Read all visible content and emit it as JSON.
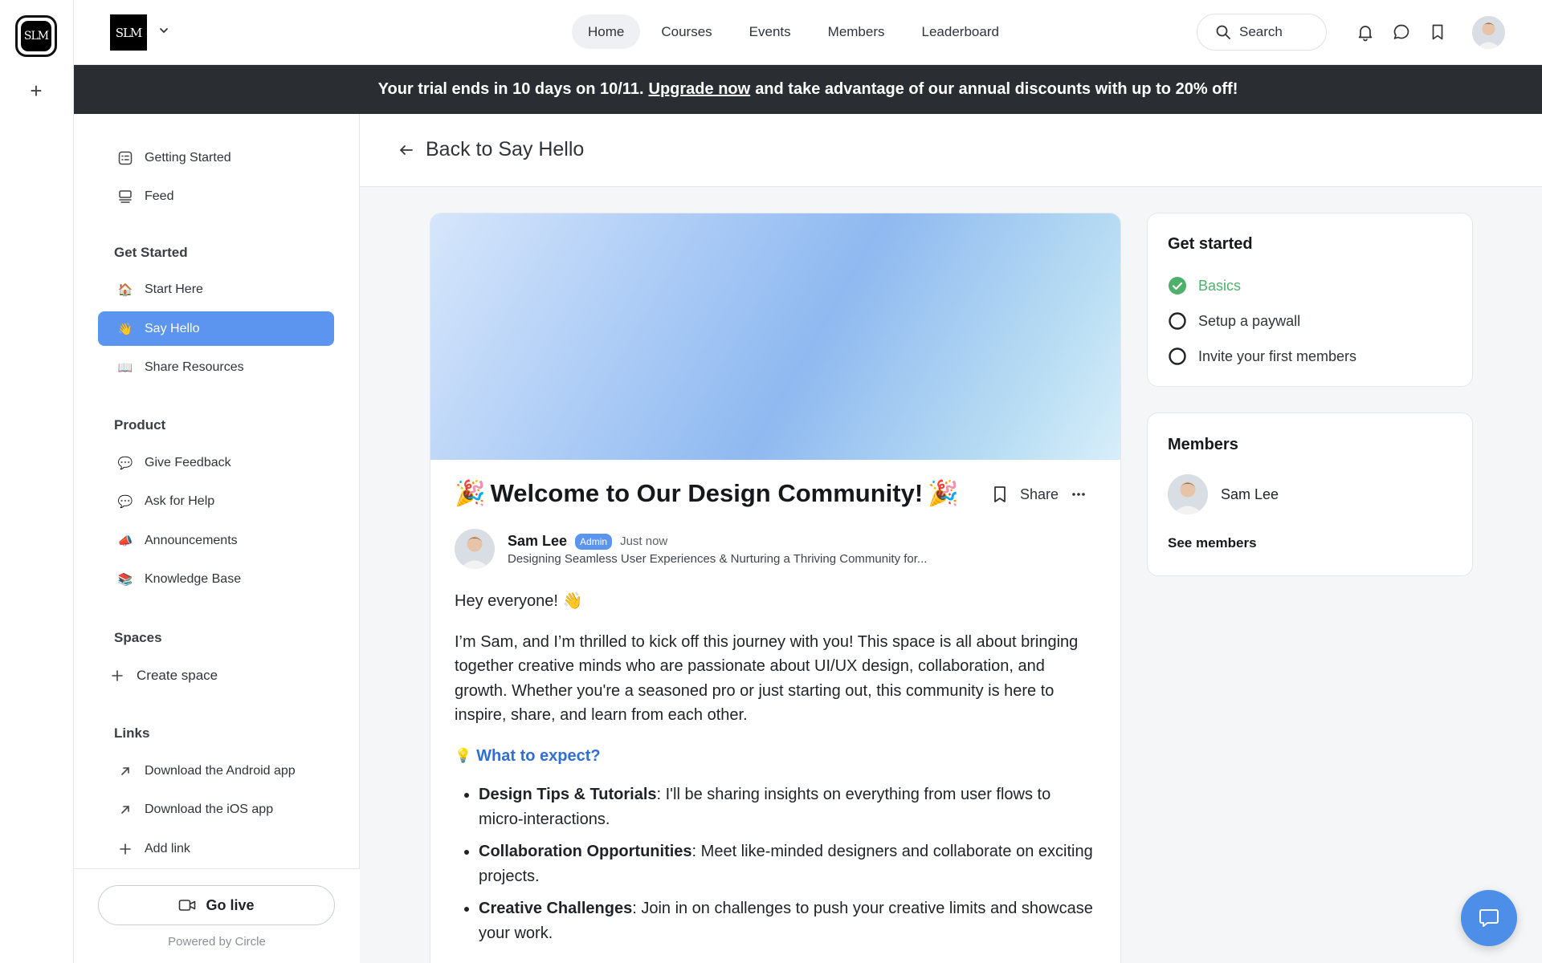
{
  "rail": {
    "logo_text": "SLM",
    "add_symbol": "+"
  },
  "header": {
    "brand_text": "SLM",
    "nav": [
      {
        "label": "Home",
        "active": true
      },
      {
        "label": "Courses",
        "active": false
      },
      {
        "label": "Events",
        "active": false
      },
      {
        "label": "Members",
        "active": false
      },
      {
        "label": "Leaderboard",
        "active": false
      }
    ],
    "search_label": "Search"
  },
  "banner": {
    "pre": "Your trial ends in 10 days on 10/11.",
    "link": "Upgrade now",
    "post": "and take advantage of our annual discounts with up to 20% off!"
  },
  "sidebar": {
    "top_items": [
      {
        "label": "Getting Started",
        "icon": "checklist-icon"
      },
      {
        "label": "Feed",
        "icon": "feed-icon"
      }
    ],
    "sections": {
      "get_started": {
        "heading": "Get Started",
        "items": [
          {
            "label": "Start Here",
            "emoji": "🏠"
          },
          {
            "label": "Say Hello",
            "emoji": "👋",
            "active": true
          },
          {
            "label": "Share Resources",
            "emoji": "📖"
          }
        ]
      },
      "product": {
        "heading": "Product",
        "items": [
          {
            "label": "Give Feedback",
            "emoji": "💬"
          },
          {
            "label": "Ask for Help",
            "emoji": "💬"
          },
          {
            "label": "Announcements",
            "emoji": "📣"
          },
          {
            "label": "Knowledge Base",
            "emoji": "📚"
          }
        ]
      },
      "spaces": {
        "heading": "Spaces",
        "create_label": "Create space"
      },
      "links": {
        "heading": "Links",
        "items": [
          {
            "label": "Download the Android app"
          },
          {
            "label": "Download the iOS app"
          }
        ],
        "add_label": "Add link"
      }
    },
    "go_live": "Go live",
    "powered_by": "Powered by Circle"
  },
  "main": {
    "back_label": "Back to Say Hello",
    "post": {
      "title": "Welcome to Our Design Community!",
      "title_emoji": "🎉",
      "share_label": "Share",
      "author": "Sam Lee",
      "badge": "Admin",
      "time": "Just now",
      "bio": "Designing Seamless User Experiences & Nurturing a Thriving Community for...",
      "greeting": "Hey everyone! 👋",
      "intro": "I’m Sam, and I’m thrilled to kick off this journey with you! This space is all about bringing together creative minds who are passionate about UI/UX design, collaboration, and growth. Whether you're a seasoned pro or just starting out, this community is here to inspire, share, and learn from each other.",
      "expect_emoji": "💡",
      "expect_heading": "What to expect?",
      "bullets": [
        {
          "bold": "Design Tips & Tutorials",
          "text": ": I'll be sharing insights on everything from user flows to micro-interactions."
        },
        {
          "bold": "Collaboration Opportunities",
          "text": ": Meet like-minded designers and collaborate on exciting projects."
        },
        {
          "bold": "Creative Challenges",
          "text": ": Join in on challenges to push your creative limits and showcase your work."
        }
      ]
    }
  },
  "right": {
    "get_started": {
      "title": "Get started",
      "items": [
        {
          "label": "Basics",
          "done": true
        },
        {
          "label": "Setup a paywall",
          "done": false
        },
        {
          "label": "Invite your first members",
          "done": false
        }
      ]
    },
    "members": {
      "title": "Members",
      "member": "Sam Lee",
      "see_all": "See members"
    }
  },
  "colors": {
    "accent": "#5b95ef",
    "banner_bg": "#2a2d31",
    "done_green": "#4fb06b",
    "link_blue": "#2f6fd6"
  }
}
